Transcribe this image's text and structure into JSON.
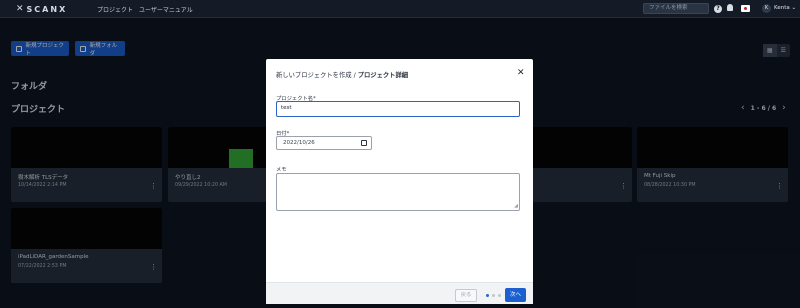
{
  "topbar": {
    "logo_text": "SCANX",
    "nav": [
      "プロジェクト",
      "ユーザーマニュアル"
    ],
    "search_placeholder": "ファイルを検索",
    "help_icon": "?",
    "user_initial": "K",
    "user_name": "Kenta ⌄"
  },
  "actions": {
    "new_project": "新規プロジェクト",
    "new_folder": "新規フォルダ"
  },
  "sections": {
    "folders": "フォルダ",
    "projects": "プロジェクト"
  },
  "pager": {
    "text": "1 - 6 / 6"
  },
  "cards": [
    {
      "name": "樹木解析 TLSデータ",
      "date": "10/14/2022 2:14 PM"
    },
    {
      "name": "やり直し2",
      "date": "09/29/2022 10:20 AM"
    },
    {
      "name": "",
      "date": ""
    },
    {
      "name": "",
      "date": ""
    },
    {
      "name": "Mt Fuji Skip",
      "date": "08/28/2022 10:30 PM"
    },
    {
      "name": "iPadLiDAR_gardenSample",
      "date": "07/22/2022 2:53 PM"
    }
  ],
  "modal": {
    "breadcrumb_prefix": "新しいプロジェクトを作成 / ",
    "breadcrumb_current": "プロジェクト詳細",
    "name_label": "プロジェクト名*",
    "name_value": "test",
    "date_label": "日付*",
    "date_value": "2022/10/26",
    "memo_label": "メモ",
    "back_label": "戻る",
    "next_label": "次へ"
  },
  "colors": {
    "accent": "#1c5fcf",
    "background": "#0f1623",
    "card": "#27313f"
  }
}
